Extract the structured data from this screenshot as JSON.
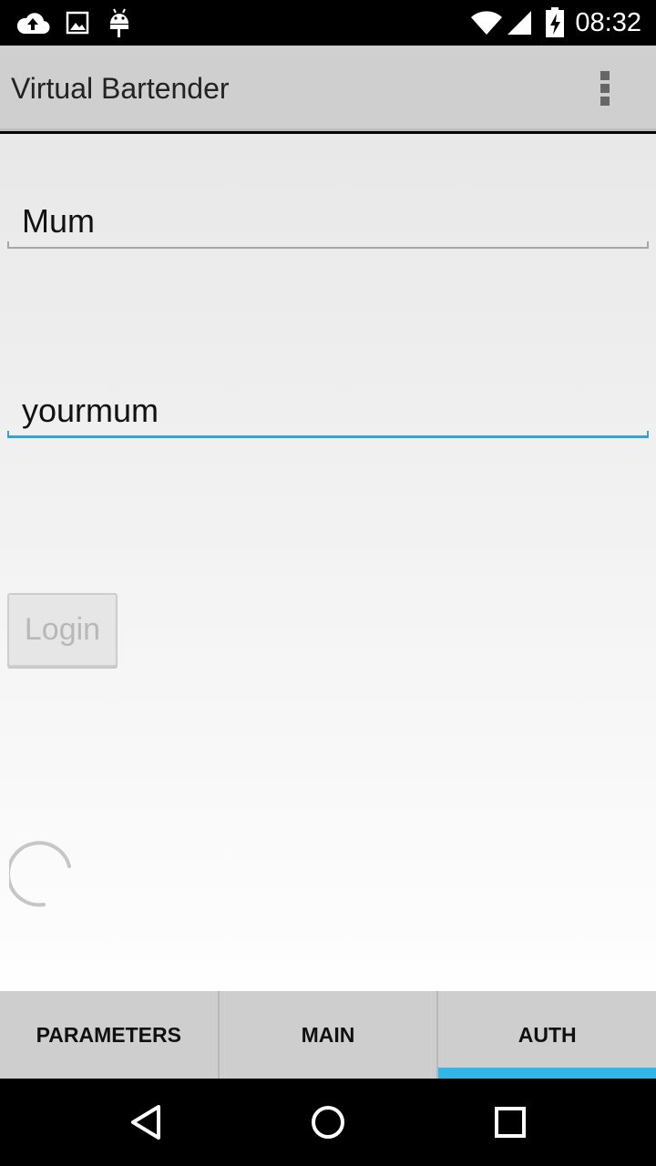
{
  "status_bar": {
    "time": "08:32",
    "icons": [
      "cloud-upload-icon",
      "image-icon",
      "android-icon",
      "wifi-icon",
      "cell-signal-icon",
      "battery-charging-icon"
    ]
  },
  "action_bar": {
    "title": "Virtual Bartender",
    "overflow_icon": "more-vert-icon"
  },
  "form": {
    "username_value": "Mum",
    "password_value": "yourmum",
    "login_label": "Login",
    "login_enabled": false
  },
  "tabs": [
    {
      "label": "PARAMETERS",
      "selected": false
    },
    {
      "label": "MAIN",
      "selected": false
    },
    {
      "label": "AUTH",
      "selected": true
    }
  ],
  "colors": {
    "accent": "#33b5e5",
    "focus_underline": "#33a5d4",
    "action_bar": "#cfcfcf",
    "tab_bar": "#cecece"
  },
  "nav_bar": {
    "icons": [
      "back-icon",
      "home-icon",
      "recents-icon"
    ]
  }
}
